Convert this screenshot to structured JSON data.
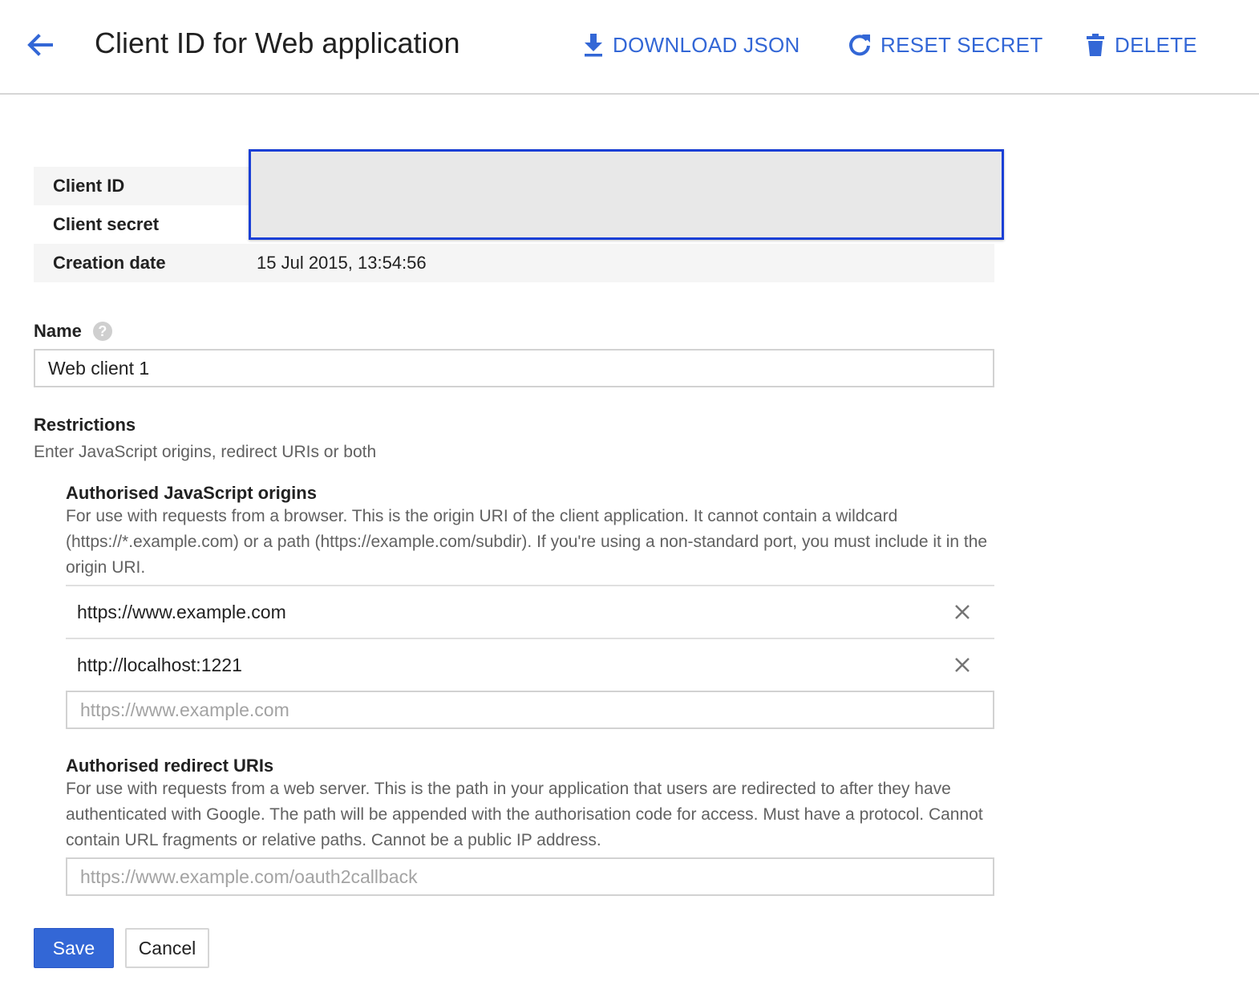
{
  "header": {
    "title": "Client ID for Web application",
    "actions": {
      "download": "DOWNLOAD JSON",
      "reset": "RESET SECRET",
      "delete": "DELETE"
    }
  },
  "info": {
    "client_id_label": "Client ID",
    "client_secret_label": "Client secret",
    "creation_date_label": "Creation date",
    "creation_date_value": "15 Jul 2015, 13:54:56"
  },
  "name": {
    "label": "Name",
    "value": "Web client 1"
  },
  "restrictions": {
    "title": "Restrictions",
    "description": "Enter JavaScript origins, redirect URIs or both",
    "origins": {
      "title": "Authorised JavaScript origins",
      "description": "For use with requests from a browser. This is the origin URI of the client application. It cannot contain a wildcard (https://*.example.com) or a path (https://example.com/subdir). If you're using a non-standard port, you must include it in the origin URI.",
      "items": [
        "https://www.example.com",
        "http://localhost:1221"
      ],
      "placeholder": "https://www.example.com"
    },
    "redirects": {
      "title": "Authorised redirect URIs",
      "description": "For use with requests from a web server. This is the path in your application that users are redirected to after they have authenticated with Google. The path will be appended with the authorisation code for access. Must have a protocol. Cannot contain URL fragments or relative paths. Cannot be a public IP address.",
      "placeholder": "https://www.example.com/oauth2callback"
    }
  },
  "buttons": {
    "save": "Save",
    "cancel": "Cancel"
  },
  "colors": {
    "accent": "#3367d6",
    "highlight_border": "#1a3fd6"
  },
  "icons": {
    "back": "arrow-back-icon",
    "download": "download-icon",
    "reset": "refresh-icon",
    "delete": "trash-icon",
    "help": "help-icon",
    "remove": "close-icon"
  }
}
